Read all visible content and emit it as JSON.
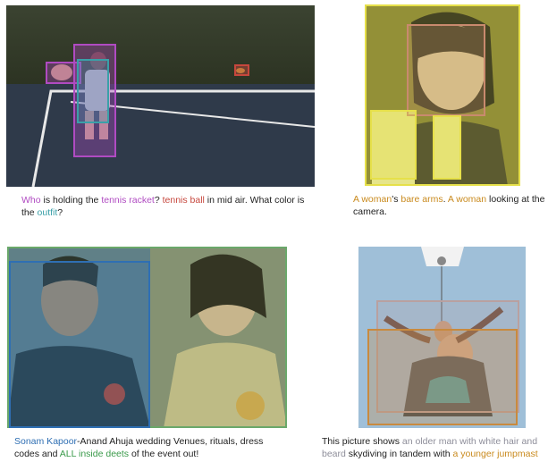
{
  "colors": {
    "purple": "#b04bc2",
    "red": "#c6473d",
    "teal": "#3aa0a8",
    "orange": "#c98a1e",
    "blue": "#2f6fb3",
    "green": "#3a9a4a",
    "grey": "#8e8e9a"
  },
  "captions": {
    "tennis": [
      {
        "text": "Who",
        "color": "purple"
      },
      {
        "text": " is holding the ",
        "color": "plain"
      },
      {
        "text": "tennis racket",
        "color": "purple"
      },
      {
        "text": "? ",
        "color": "plain"
      },
      {
        "text": "tennis ball",
        "color": "red"
      },
      {
        "text": " in mid air. What color is the ",
        "color": "plain"
      },
      {
        "text": "outfit",
        "color": "teal"
      },
      {
        "text": "?",
        "color": "plain"
      }
    ],
    "woman": [
      {
        "text": "A woman",
        "color": "orange"
      },
      {
        "text": "'s ",
        "color": "plain"
      },
      {
        "text": "bare arms",
        "color": "orange"
      },
      {
        "text": ". ",
        "color": "plain"
      },
      {
        "text": "A woman",
        "color": "orange"
      },
      {
        "text": " looking at the camera.",
        "color": "plain"
      }
    ],
    "couple": [
      {
        "text": "Sonam Kapoor",
        "color": "blue"
      },
      {
        "text": "-Anand Ahuja wedding Venues, rituals, dress codes and ",
        "color": "plain"
      },
      {
        "text": "ALL inside deets",
        "color": "green"
      },
      {
        "text": " of the event out!",
        "color": "plain"
      }
    ],
    "skydiving": [
      {
        "text": "This picture shows ",
        "color": "plain"
      },
      {
        "text": "an older man with white hair and beard",
        "color": "grey"
      },
      {
        "text": " skydiving in tandem with ",
        "color": "plain"
      },
      {
        "text": "a younger jumpmast",
        "color": "orange"
      }
    ]
  }
}
